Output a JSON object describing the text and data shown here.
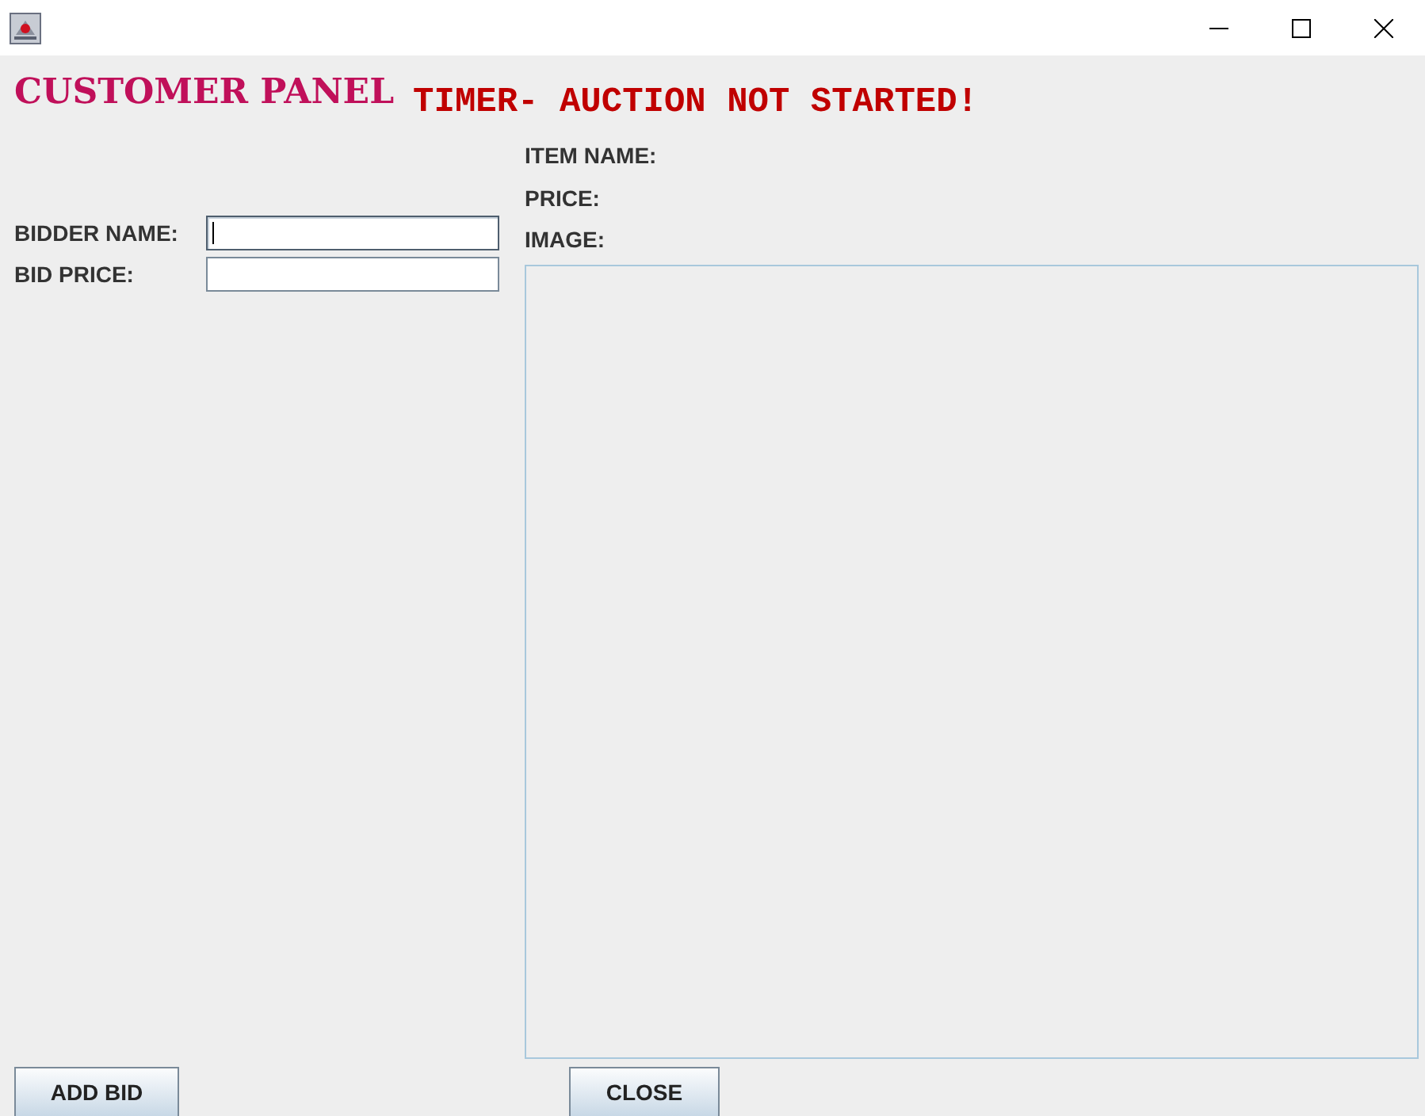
{
  "heading": {
    "title": "CUSTOMER PANEL",
    "timer": "TIMER- AUCTION NOT STARTED!"
  },
  "bid_form": {
    "fields": [
      {
        "label": "BIDDER NAME:",
        "focused": true
      },
      {
        "label": "BID PRICE:",
        "focused": false
      }
    ]
  },
  "item": {
    "labels": [
      "ITEM NAME:",
      "PRICE:",
      "IMAGE:"
    ]
  },
  "buttons": [
    "ADD BID",
    "CLOSE"
  ]
}
